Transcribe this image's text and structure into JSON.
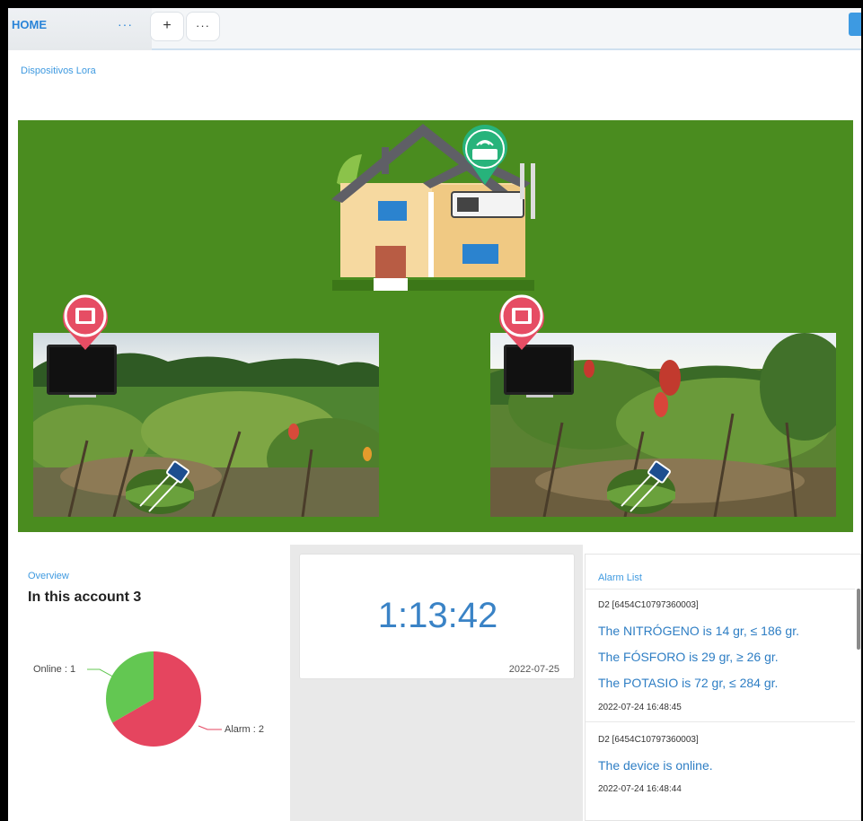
{
  "header": {
    "home_label": "HOME",
    "home_menu": "···",
    "add_tab": "+",
    "more_tab": "···"
  },
  "lora": {
    "title": "Dispositivos Lora"
  },
  "overview": {
    "title": "Overview",
    "account_text": "In this account 3",
    "online_label": "Online : 1",
    "alarm_label": "Alarm : 2",
    "online_count": 1,
    "alarm_count": 2,
    "online_color": "#63c752",
    "alarm_color": "#e5455f"
  },
  "clock": {
    "time": "1:13:42",
    "date": "2022-07-25"
  },
  "alarms": {
    "title": "Alarm List",
    "items": [
      {
        "device": "D2 [6454C10797360003]",
        "messages": [
          "The NITRÓGENO is 14 gr, ≤ 186 gr.",
          "The FÓSFORO is 29 gr, ≥ 26 gr.",
          "The POTASIO is 72 gr, ≤ 284 gr."
        ],
        "time": "2022-07-24 16:48:45"
      },
      {
        "device": "D2 [6454C10797360003]",
        "messages": [
          "The device is online."
        ],
        "time": "2022-07-24 16:48:44"
      }
    ]
  },
  "colors": {
    "accent": "#3f9ae0",
    "field_green": "#4a8c1f"
  }
}
